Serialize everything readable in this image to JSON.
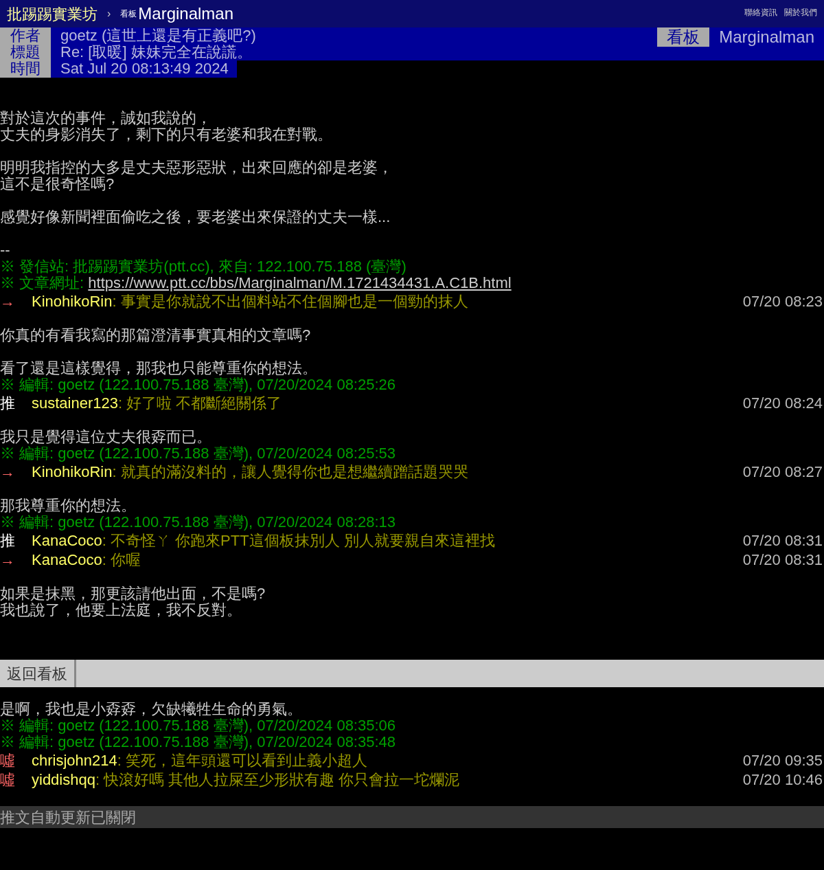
{
  "topbar": {
    "site": "批踢踢實業坊",
    "separator": "›",
    "board_label": "看板",
    "board": "Marginalman",
    "links": [
      "聯絡資訊",
      "關於我們"
    ]
  },
  "meta": {
    "rows": [
      {
        "label": "作者",
        "value": "goetz (這世上還是有正義吧?)"
      },
      {
        "label": "標題",
        "value": "Re: [取暖] 妹妹完全在說謊。"
      },
      {
        "label": "時間",
        "value": "Sat Jul 20 08:13:49 2024"
      }
    ],
    "board_tag": {
      "label": "看板",
      "value": "Marginalman"
    }
  },
  "lines": [
    {
      "kind": "blank"
    },
    {
      "kind": "text",
      "text": "對於這次的事件，誠如我說的，"
    },
    {
      "kind": "text",
      "text": "丈夫的身影消失了，剩下的只有老婆和我在對戰。"
    },
    {
      "kind": "blank"
    },
    {
      "kind": "text",
      "text": "明明我指控的大多是丈夫惡形惡狀，出來回應的卻是老婆，"
    },
    {
      "kind": "text",
      "text": "這不是很奇怪嗎?"
    },
    {
      "kind": "blank"
    },
    {
      "kind": "text",
      "text": "感覺好像新聞裡面偷吃之後，要老婆出來保證的丈夫一樣..."
    },
    {
      "kind": "blank"
    },
    {
      "kind": "text",
      "text": "--"
    },
    {
      "kind": "sig",
      "text": "※ 發信站: 批踢踢實業坊(ptt.cc), 來自: 122.100.75.188 (臺灣)"
    },
    {
      "kind": "url",
      "text": "※ 文章網址: ",
      "url": "https://www.ptt.cc/bbs/Marginalman/M.1721434431.A.C1B.html"
    },
    {
      "kind": "push",
      "tag": "→",
      "color": "#ff6666",
      "user": "KinohikoRin",
      "content": ": 事實是你就說不出個料站不住個腳也是一個勁的抹人",
      "time": "07/20 08:23"
    },
    {
      "kind": "blank"
    },
    {
      "kind": "text",
      "text": "你真的有看我寫的那篇澄清事實真相的文章嗎?"
    },
    {
      "kind": "blank"
    },
    {
      "kind": "text",
      "text": "看了還是這樣覺得，那我也只能尊重你的想法。"
    },
    {
      "kind": "sig",
      "text": "※ 編輯: goetz (122.100.75.188 臺灣), 07/20/2024 08:25:26"
    },
    {
      "kind": "push",
      "tag": "推",
      "color": "#ffffff",
      "user": "sustainer123",
      "content": ": 好了啦 不都斷絕關係了",
      "time": "07/20 08:24"
    },
    {
      "kind": "blank"
    },
    {
      "kind": "text",
      "text": "我只是覺得這位丈夫很孬而已。"
    },
    {
      "kind": "sig",
      "text": "※ 編輯: goetz (122.100.75.188 臺灣), 07/20/2024 08:25:53"
    },
    {
      "kind": "push",
      "tag": "→",
      "color": "#ff6666",
      "user": "KinohikoRin",
      "content": ": 就真的滿沒料的，讓人覺得你也是想繼續蹭話題哭哭",
      "time": "07/20 08:27"
    },
    {
      "kind": "blank"
    },
    {
      "kind": "text",
      "text": "那我尊重你的想法。"
    },
    {
      "kind": "sig",
      "text": "※ 編輯: goetz (122.100.75.188 臺灣), 07/20/2024 08:28:13"
    },
    {
      "kind": "push",
      "tag": "推",
      "color": "#ffffff",
      "user": "KanaCoco",
      "content": ": 不奇怪ㄚ 你跑來PTT這個板抹別人 別人就要親自來這裡找",
      "time": "07/20 08:31"
    },
    {
      "kind": "push",
      "tag": "→",
      "color": "#ff6666",
      "user": "KanaCoco",
      "content": ": 你喔",
      "time": "07/20 08:31"
    },
    {
      "kind": "blank"
    },
    {
      "kind": "text",
      "text": "如果是抹黑，那更該請他出面，不是嗎?"
    },
    {
      "kind": "text",
      "text": "我也說了，他要上法庭，我不反對。"
    },
    {
      "kind": "blank"
    },
    {
      "kind": "blank"
    },
    {
      "kind": "blank"
    },
    {
      "kind": "blank"
    },
    {
      "kind": "blank"
    },
    {
      "kind": "text",
      "text": "是啊，我也是小孬孬，欠缺犧牲生命的勇氣。"
    },
    {
      "kind": "sig",
      "text": "※ 編輯: goetz (122.100.75.188 臺灣), 07/20/2024 08:35:06"
    },
    {
      "kind": "sig",
      "text": "※ 編輯: goetz (122.100.75.188 臺灣), 07/20/2024 08:35:48"
    },
    {
      "kind": "push",
      "tag": "噓",
      "color": "#ff6666",
      "user": "chrisjohn214",
      "content": ": 笑死，這年頭還可以看到止義小超人",
      "time": "07/20 09:35"
    },
    {
      "kind": "push",
      "tag": "噓",
      "color": "#ff6666",
      "user": "yiddishqq",
      "content": ": 快滾好嗎 其他人拉屎至少形狀有趣 你只會拉一坨爛泥",
      "time": "07/20 10:46"
    }
  ],
  "back_bar": {
    "button": "返回看板"
  },
  "status": "推文自動更新已關閉"
}
